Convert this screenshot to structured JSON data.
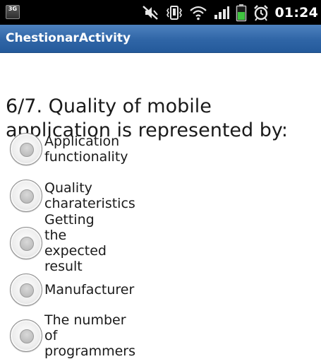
{
  "status_bar": {
    "network_badge": "3G",
    "icons": [
      "mute-icon",
      "vibrate-icon",
      "wifi-icon",
      "signal-icon",
      "battery-icon",
      "alarm-icon"
    ],
    "time": "01:24",
    "colors": {
      "background": "#000000",
      "battery": "#3fc43f"
    }
  },
  "title_bar": {
    "title": "ChestionarActivity",
    "colors": {
      "background": "#2f65a6",
      "text": "#ffffff"
    }
  },
  "question": {
    "text": "6/7. Quality of mobile application is represented by:"
  },
  "options": [
    {
      "label": "Application functionality",
      "selected": false
    },
    {
      "label": "Quality charateristics",
      "selected": false
    },
    {
      "label": "Getting the expected result",
      "selected": false
    },
    {
      "label": "Manufacturer",
      "selected": false
    },
    {
      "label": "The number of programmers",
      "selected": false
    }
  ]
}
